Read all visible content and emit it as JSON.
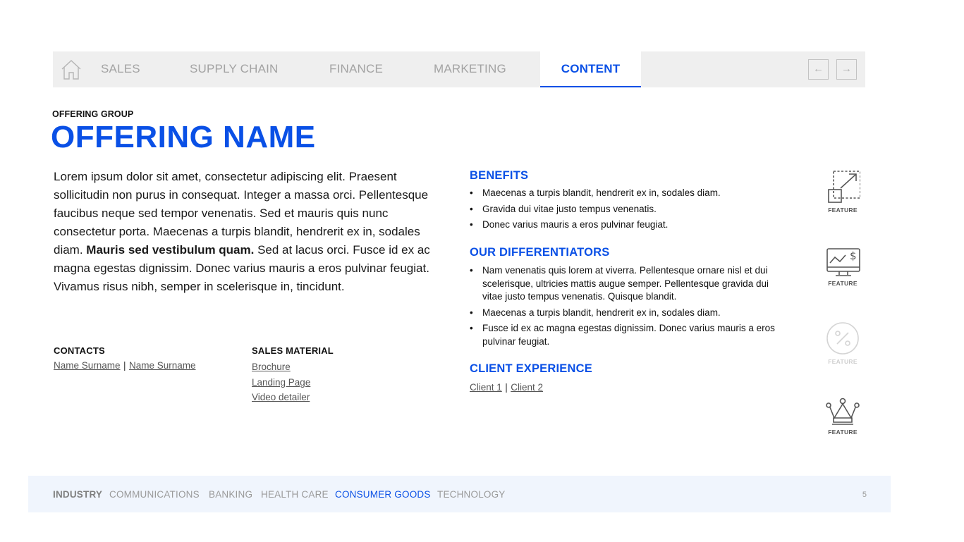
{
  "nav": {
    "tabs": [
      {
        "label": "SALES"
      },
      {
        "label": "SUPPLY CHAIN"
      },
      {
        "label": "FINANCE"
      },
      {
        "label": "MARKETING"
      },
      {
        "label": "CONTENT"
      }
    ],
    "active_tab": "CONTENT",
    "prev_symbol": "←",
    "next_symbol": "→"
  },
  "header": {
    "group": "OFFERING GROUP",
    "name": "OFFERING NAME"
  },
  "body": {
    "text_before": "Lorem ipsum dolor sit amet, consectetur adipiscing elit. Praesent sollicitudin non purus in consequat. Integer a massa orci. Pellentesque faucibus neque sed tempor venenatis. Sed et mauris quis nunc consectetur porta. Maecenas a turpis blandit, hendrerit ex in, sodales diam. ",
    "text_bold": "Mauris sed vestibulum quam.",
    "text_after": " Sed at lacus orci. Fusce id ex ac magna egestas dignissim. Donec varius mauris a eros pulvinar feugiat. Vivamus risus nibh, semper in scelerisque in, tincidunt."
  },
  "contacts": {
    "label": "CONTACTS",
    "links": [
      "Name Surname",
      "Name Surname"
    ],
    "separator": "|"
  },
  "sales_material": {
    "label": "SALES MATERIAL",
    "links": [
      "Brochure",
      "Landing Page",
      "Video detailer"
    ]
  },
  "benefits": {
    "heading": "BENEFITS",
    "items": [
      "Maecenas a turpis blandit, hendrerit ex in, sodales diam.",
      "Gravida dui vitae justo tempus venenatis.",
      "Donec varius mauris a eros pulvinar feugiat."
    ]
  },
  "differentiators": {
    "heading": "OUR DIFFERENTIATORS",
    "items": [
      "Nam venenatis quis lorem at viverra. Pellentesque ornare nisl et dui scelerisque, ultricies mattis augue semper. Pellentesque gravida dui vitae justo tempus venenatis. Quisque blandit.",
      "Maecenas a turpis blandit, hendrerit ex in, sodales diam.",
      "Fusce id ex ac magna egestas dignissim. Donec varius mauris a eros pulvinar feugiat."
    ]
  },
  "client_experience": {
    "heading": "CLIENT EXPERIENCE",
    "links": [
      "Client 1",
      "Client 2"
    ],
    "separator": "|"
  },
  "features": [
    {
      "label": "FEATURE",
      "icon": "resize-arrow-icon"
    },
    {
      "label": "FEATURE",
      "icon": "monitor-dollar-icon"
    },
    {
      "label": "FEATURE",
      "icon": "percent-circle-icon"
    },
    {
      "label": "FEATURE",
      "icon": "crown-icon"
    }
  ],
  "footer": {
    "title": "INDUSTRY",
    "items": [
      "COMMUNICATIONS",
      "BANKING",
      "HEALTH CARE",
      "CONSUMER GOODS",
      "TECHNOLOGY"
    ],
    "active_item": "CONSUMER GOODS",
    "page_number": "5"
  },
  "colors": {
    "accent": "#0a50e6",
    "nav_background": "#efefef",
    "footer_background": "#f0f5fd",
    "inactive_text": "#a3a3a3"
  }
}
